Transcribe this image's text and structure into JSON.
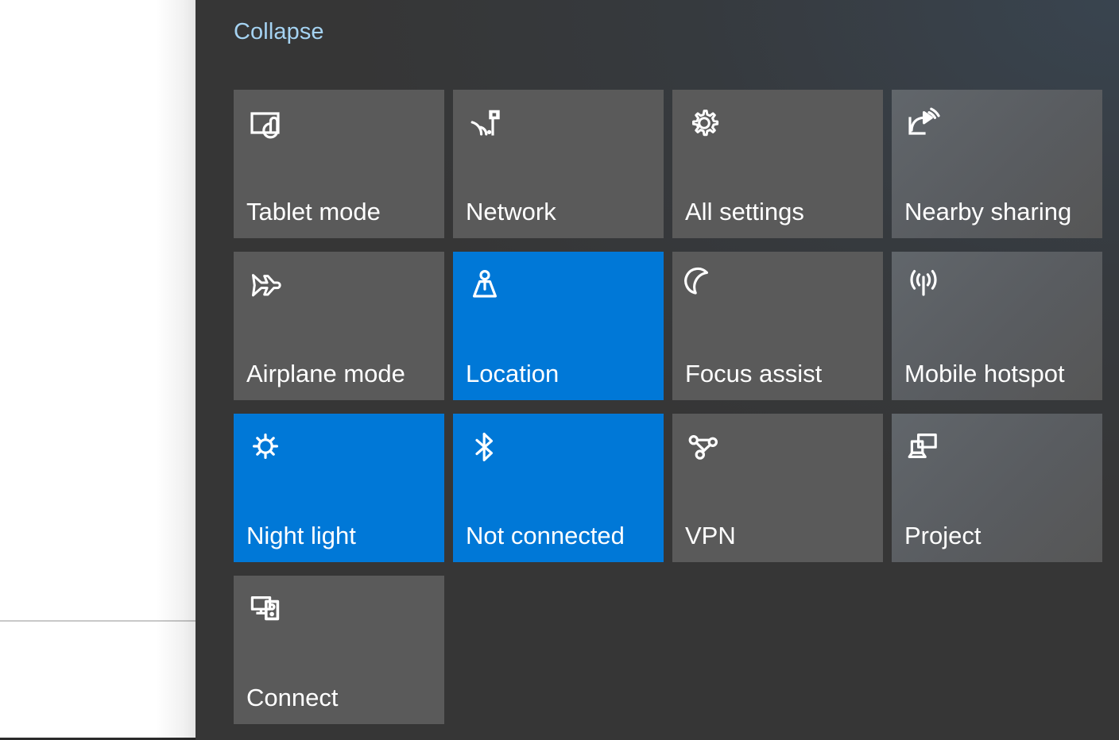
{
  "colors": {
    "panel_background": "#363636",
    "tile_inactive": "#5a5a5a",
    "tile_active": "#0078d7",
    "accent_link": "#a5d3f2",
    "label_text": "#ffffff",
    "left_surface": "#ffffff",
    "left_divider": "#c8c8c8"
  },
  "action_center": {
    "collapse_label": "Collapse",
    "tiles": [
      {
        "label": "Tablet mode",
        "icon": "tablet-mode-icon",
        "state": "off",
        "style": "plain"
      },
      {
        "label": "Network",
        "icon": "network-icon",
        "state": "off",
        "style": "plain"
      },
      {
        "label": "All settings",
        "icon": "gear-icon",
        "state": "off",
        "style": "plain"
      },
      {
        "label": "Nearby sharing",
        "icon": "nearby-sharing-icon",
        "state": "off",
        "style": "tinted"
      },
      {
        "label": "Airplane mode",
        "icon": "airplane-icon",
        "state": "off",
        "style": "plain"
      },
      {
        "label": "Location",
        "icon": "location-pin-icon",
        "state": "on",
        "style": "plain"
      },
      {
        "label": "Focus assist",
        "icon": "moon-icon",
        "state": "off",
        "style": "plain"
      },
      {
        "label": "Mobile hotspot",
        "icon": "broadcast-icon",
        "state": "off",
        "style": "tinted"
      },
      {
        "label": "Night light",
        "icon": "night-light-icon",
        "state": "on",
        "style": "plain"
      },
      {
        "label": "Not connected",
        "icon": "bluetooth-icon",
        "state": "on",
        "style": "plain"
      },
      {
        "label": "VPN",
        "icon": "vpn-icon",
        "state": "off",
        "style": "plain"
      },
      {
        "label": "Project",
        "icon": "project-icon",
        "state": "off",
        "style": "tinted"
      },
      {
        "label": "Connect",
        "icon": "connect-icon",
        "state": "off",
        "style": "plain"
      }
    ]
  }
}
